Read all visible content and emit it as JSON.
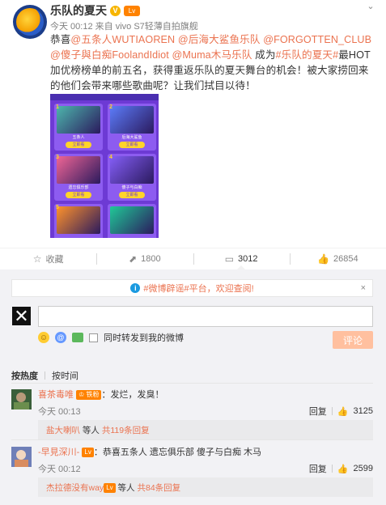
{
  "post": {
    "nickname": "乐队的夏天",
    "verified_badge": "V",
    "level_badge": "Lv",
    "time": "今天 00:12",
    "source": "来自 vivo S7轻薄自拍旗舰",
    "text_parts": [
      {
        "t": "恭喜",
        "link": false
      },
      {
        "t": "@五条人WUTIAOREN",
        "link": true
      },
      {
        "t": " ",
        "link": false
      },
      {
        "t": "@后海大鲨鱼乐队",
        "link": true
      },
      {
        "t": " ",
        "link": false
      },
      {
        "t": "@FORGOTTEN_CLUB",
        "link": true
      },
      {
        "t": " ",
        "link": false
      },
      {
        "t": "@傻子與白痴FoolandIdiot",
        "link": true
      },
      {
        "t": " ",
        "link": false
      },
      {
        "t": "@Muma木马乐队",
        "link": true
      },
      {
        "t": " 成为",
        "link": false
      },
      {
        "t": "#乐队的夏天#",
        "link": true
      },
      {
        "t": "最HOT加优榜榜单的前五名，获得重返乐队的夏天舞台的机会！被大家捞回来的他们会带来哪些歌曲呢？让我们拭目以待！",
        "link": false
      }
    ],
    "poster_cards": [
      {
        "num": "1",
        "name": "五条人",
        "btn": "立即看"
      },
      {
        "num": "2",
        "name": "后海大鲨鱼",
        "btn": "立即看"
      },
      {
        "num": "3",
        "name": "遗忘俱乐部",
        "btn": "立即看"
      },
      {
        "num": "4",
        "name": "傻子与白痴",
        "btn": "立即看"
      },
      {
        "num": "5",
        "name": "",
        "btn": ""
      },
      {
        "num": "",
        "name": "",
        "btn": ""
      }
    ]
  },
  "actions": {
    "favorite": {
      "label": "收藏",
      "icon": "star-icon"
    },
    "forward": {
      "label": "1800",
      "icon": "forward-icon"
    },
    "comment": {
      "label": "3012",
      "icon": "comment-icon"
    },
    "like": {
      "label": "26854",
      "icon": "thumb-up-icon"
    }
  },
  "comments_panel": {
    "notice_text": "#微博辟谣#平台，欢迎查阅!",
    "notice_close": "×",
    "input_value": "",
    "also_forward_label": "同时转发到我的微博",
    "post_button": "评论",
    "sort_hot": "按热度",
    "sort_time": "按时间",
    "colors": {
      "accent": "#eb7350",
      "button_disabled": "#ffc09f",
      "panel_bg": "#f2f2f5"
    }
  },
  "comments": [
    {
      "user": "喜茶毒唯",
      "badge": "铁粉",
      "text": "：发烂，发臭！",
      "time": "今天 00:13",
      "reply_label": "回复",
      "likes": "3125",
      "sub_user": "盐大喇叭",
      "sub_text": " 等人 ",
      "sub_total": "共119条回复"
    },
    {
      "user": "-早見深川-",
      "badge": "",
      "text": "：恭喜五条人 遗忘俱乐部 傻子与白痴 木马",
      "time": "今天 00:12",
      "reply_label": "回复",
      "likes": "2599",
      "sub_user": "杰拉德没有way",
      "sub_text": " 等人 ",
      "sub_total": "共84条回复"
    }
  ]
}
